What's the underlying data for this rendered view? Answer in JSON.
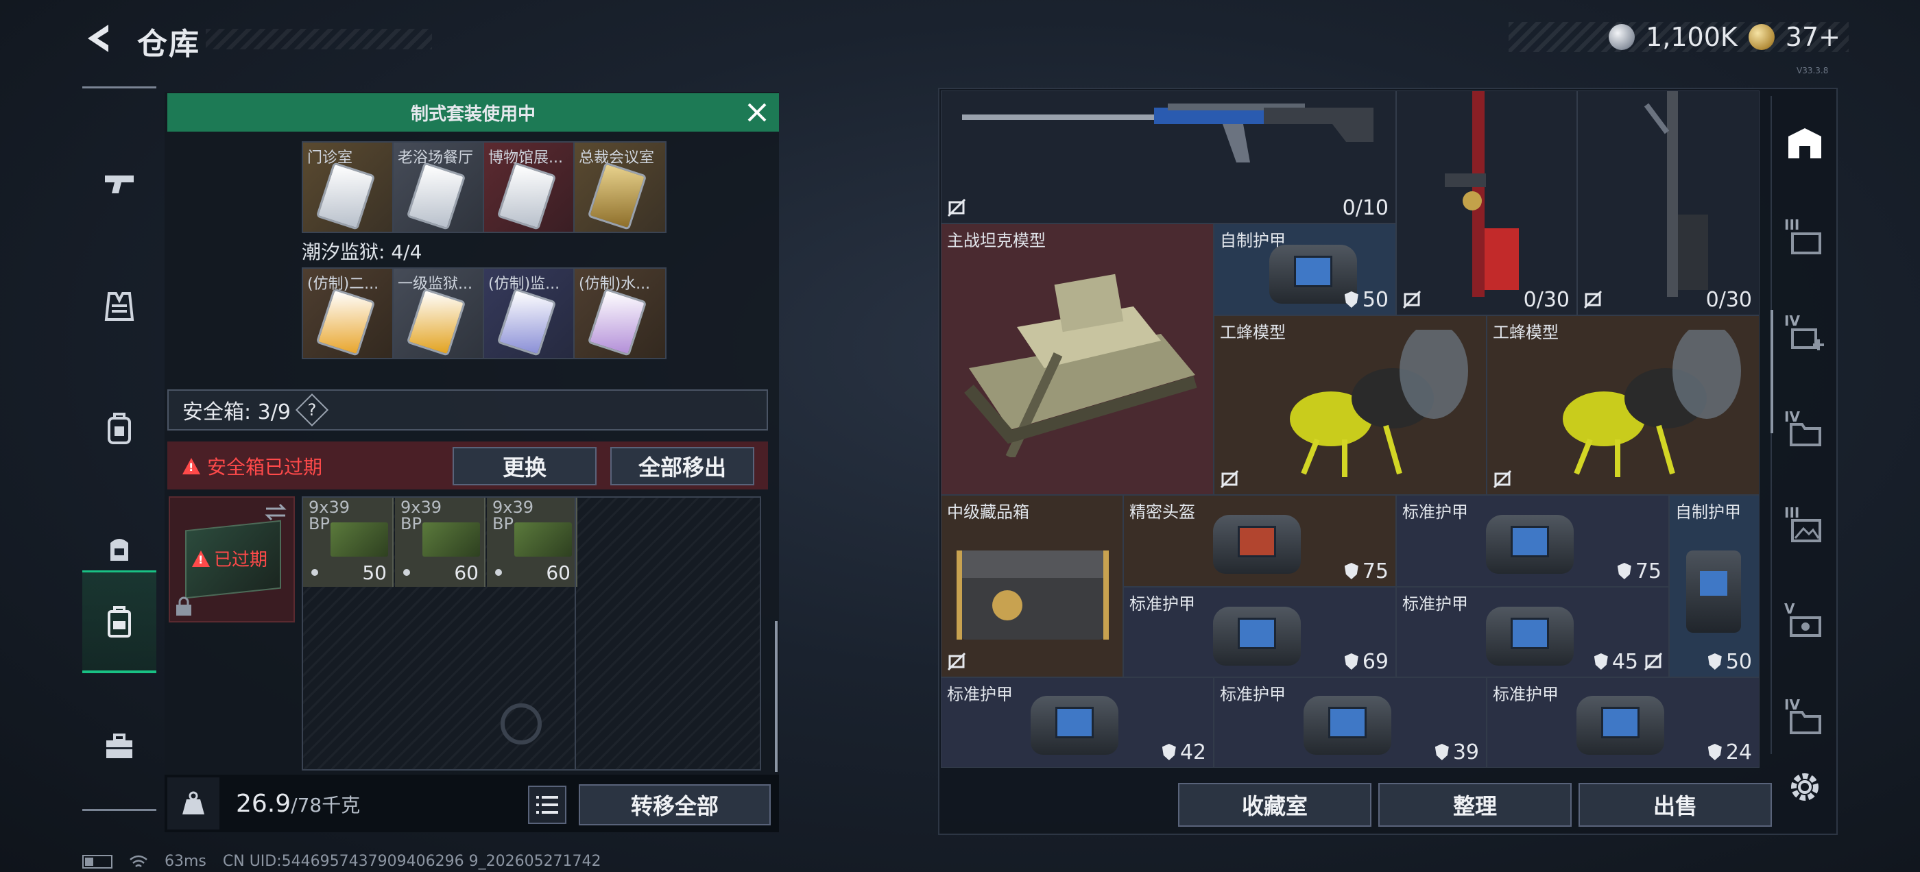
{
  "header": {
    "title": "仓库",
    "currency": [
      {
        "icon": "silver-coin-icon",
        "value": "1,100K"
      },
      {
        "icon": "gold-coin-icon",
        "value": "37+"
      }
    ],
    "version": "V33.3.8"
  },
  "left_nav": {
    "items": [
      "pistol-icon",
      "vest-icon",
      "backpack-icon",
      "gear-pack-icon",
      "safebox-icon",
      "briefcase-icon"
    ],
    "active": "safebox-icon"
  },
  "suit_banner": {
    "label": "制式套装使用中"
  },
  "cards_row1": [
    {
      "label": "门诊室",
      "color": "gold"
    },
    {
      "label": "老浴场餐厅",
      "color": "gray"
    },
    {
      "label": "博物馆展...",
      "color": "red"
    },
    {
      "label": "总裁会议室",
      "color": "gold"
    }
  ],
  "prison_label": "潮汐监狱: 4/4",
  "cards_row2": [
    {
      "label": "(仿制)二...",
      "color": "brown"
    },
    {
      "label": "一级监狱...",
      "color": "gray"
    },
    {
      "label": "(仿制)监...",
      "color": "navy"
    },
    {
      "label": "(仿制)水...",
      "color": "brown"
    }
  ],
  "safebox": {
    "label": "安全箱: 3/9",
    "help": "?",
    "expired_notice": "安全箱已过期",
    "replace_label": "更换",
    "remove_all_label": "全部移出",
    "slot_expired": "已过期"
  },
  "ammo": [
    {
      "label_line1": "9x39",
      "label_line2": "BP",
      "count": "50"
    },
    {
      "label_line1": "9x39",
      "label_line2": "BP",
      "count": "60"
    },
    {
      "label_line1": "9x39",
      "label_line2": "BP",
      "count": "60"
    }
  ],
  "bottom_left": {
    "weight_value": "26.9",
    "weight_max": "/78千克",
    "transfer_all_label": "转移全部"
  },
  "stash": {
    "rifle_count": "0/10",
    "weapon2_count": "0/30",
    "weapon3_count": "0/30",
    "tank": {
      "label": "主战坦克模型"
    },
    "armor_top": {
      "label": "自制护甲",
      "value": "50"
    },
    "wasp1": {
      "label": "工蜂模型"
    },
    "wasp2": {
      "label": "工蜂模型"
    },
    "crate": {
      "label": "中级藏品箱"
    },
    "helmet": {
      "label": "精密头盔",
      "value": "75"
    },
    "armor_a": {
      "label": "标准护甲",
      "value": "75"
    },
    "armor_b": {
      "label": "自制护甲",
      "value": "50"
    },
    "armor_c": {
      "label": "标准护甲",
      "value": "69"
    },
    "armor_d": {
      "label": "标准护甲",
      "value": "45"
    },
    "armor_e": {
      "label": "标准护甲",
      "value": "42"
    },
    "armor_f": {
      "label": "标准护甲",
      "value": "39"
    },
    "armor_g": {
      "label": "标准护甲",
      "value": "24"
    }
  },
  "bottom_right": {
    "collection_label": "收藏室",
    "organize_label": "整理",
    "sell_label": "出售"
  },
  "right_tabs": [
    {
      "icon": "stash-home-icon",
      "level": ""
    },
    {
      "icon": "stash-tab-3-icon",
      "level": "III"
    },
    {
      "icon": "stash-tab-4-add-icon",
      "level": "IV"
    },
    {
      "icon": "stash-tab-4-folder-icon",
      "level": "IV"
    },
    {
      "icon": "stash-tab-3-photo-icon",
      "level": "III"
    },
    {
      "icon": "stash-tab-5-icon",
      "level": "V"
    },
    {
      "icon": "stash-tab-4-folder-icon",
      "level": "IV"
    }
  ],
  "footer": {
    "ping": "63ms",
    "uid": "CN UID:5446957437909406296 9_202605271742"
  }
}
